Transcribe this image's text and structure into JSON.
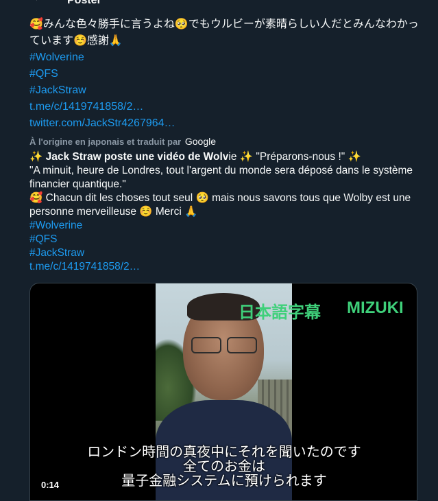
{
  "header": {
    "title": "Poster",
    "back_icon": "arrow-left-icon"
  },
  "post": {
    "original_text": "🥰みんな色々勝手に言うよね🥺でもウルビーが素晴らしい人だとみんなわかっています☺️感謝🙏",
    "hashtags": [
      "#Wolverine",
      "#QFS",
      "#JackStraw"
    ],
    "links": [
      "t.me/c/1419741858/2…",
      "twitter.com/JackStr4267964…"
    ],
    "translation_note": "À l'origine en japonais et traduit par",
    "translation_provider": "Google",
    "fr_line1_bold": "Jack Straw poste une vidéo de Wolv",
    "fr_line1_rest": "ie",
    "fr_line1_quote": "\"Préparons-nous !\"",
    "fr_line2": "\"A minuit, heure de Londres, tout l'argent du monde sera déposé dans le système financier quantique.\"",
    "fr_line3a": "Chacun dit les choses tout seul",
    "fr_line3b": "mais nous savons tous que Wolby est une personne merveilleuse",
    "fr_line3c": "Merci",
    "fr_hashtags": [
      "#Wolverine",
      "#QFS",
      "#JackStraw"
    ],
    "fr_link": "t.me/c/1419741858/2…"
  },
  "video": {
    "badge_jp": "日本語字幕",
    "badge_name": "MIZUKI",
    "subtitle_lines": [
      "ロンドン時間の真夜中にそれを聞いたのです",
      "全てのお金は",
      "量子金融システムに預けられます"
    ],
    "timestamp": "0:14"
  }
}
